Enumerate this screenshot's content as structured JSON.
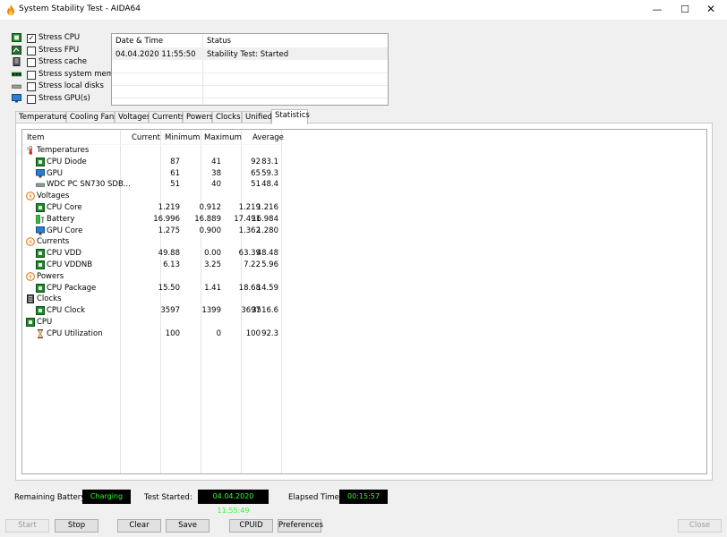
{
  "window": {
    "title": "System Stability Test - AIDA64",
    "minimize": "—",
    "maximize": "☐",
    "close": "✕"
  },
  "stress_options": [
    {
      "label": "Stress CPU",
      "checked": "✓",
      "icon": "cpu-chip-icon"
    },
    {
      "label": "Stress FPU",
      "checked": "",
      "icon": "fpu-chip-icon"
    },
    {
      "label": "Stress cache",
      "checked": "",
      "icon": "cache-icon"
    },
    {
      "label": "Stress system memory",
      "checked": "",
      "icon": "memory-icon"
    },
    {
      "label": "Stress local disks",
      "checked": "",
      "icon": "disk-icon"
    },
    {
      "label": "Stress GPU(s)",
      "checked": "",
      "icon": "gpu-monitor-icon"
    }
  ],
  "log": {
    "headers": {
      "date": "Date & Time",
      "status": "Status"
    },
    "rows": [
      {
        "date": "04.04.2020 11:55:50",
        "status": "Stability Test: Started"
      }
    ]
  },
  "tabs": [
    "Temperatures",
    "Cooling Fans",
    "Voltages",
    "Currents",
    "Powers",
    "Clocks",
    "Unified",
    "Statistics"
  ],
  "active_tab": "Statistics",
  "stats": {
    "headers": {
      "item": "Item",
      "current": "Current",
      "minimum": "Minimum",
      "maximum": "Maximum",
      "average": "Average"
    },
    "rows": [
      {
        "kind": "group",
        "name": "Temperatures",
        "icon": "thermometer-icon"
      },
      {
        "kind": "item",
        "name": "CPU Diode",
        "icon": "cpu-chip-icon",
        "current": "87",
        "minimum": "41",
        "maximum": "92",
        "average": "83.1"
      },
      {
        "kind": "item",
        "name": "GPU",
        "icon": "gpu-monitor-icon",
        "current": "61",
        "minimum": "38",
        "maximum": "65",
        "average": "59.3"
      },
      {
        "kind": "item",
        "name": "WDC PC SN730 SDB...",
        "icon": "disk-icon",
        "current": "51",
        "minimum": "40",
        "maximum": "51",
        "average": "48.4"
      },
      {
        "kind": "group",
        "name": "Voltages",
        "icon": "voltage-icon"
      },
      {
        "kind": "item",
        "name": "CPU Core",
        "icon": "cpu-chip-icon",
        "current": "1.219",
        "minimum": "0.912",
        "maximum": "1.219",
        "average": "1.216"
      },
      {
        "kind": "item",
        "name": "Battery",
        "icon": "battery-icon",
        "current": "16.996",
        "minimum": "16.889",
        "maximum": "17.491",
        "average": "16.984"
      },
      {
        "kind": "item",
        "name": "GPU Core",
        "icon": "gpu-monitor-icon",
        "current": "1.275",
        "minimum": "0.900",
        "maximum": "1.362",
        "average": "1.280"
      },
      {
        "kind": "group",
        "name": "Currents",
        "icon": "current-icon"
      },
      {
        "kind": "item",
        "name": "CPU VDD",
        "icon": "cpu-chip-icon",
        "current": "49.88",
        "minimum": "0.00",
        "maximum": "63.39",
        "average": "48.48"
      },
      {
        "kind": "item",
        "name": "CPU VDDNB",
        "icon": "cpu-chip-icon",
        "current": "6.13",
        "minimum": "3.25",
        "maximum": "7.22",
        "average": "5.96"
      },
      {
        "kind": "group",
        "name": "Powers",
        "icon": "power-icon"
      },
      {
        "kind": "item",
        "name": "CPU Package",
        "icon": "cpu-chip-icon",
        "current": "15.50",
        "minimum": "1.41",
        "maximum": "18.68",
        "average": "14.59"
      },
      {
        "kind": "group",
        "name": "Clocks",
        "icon": "clock-chip-icon"
      },
      {
        "kind": "item",
        "name": "CPU Clock",
        "icon": "cpu-chip-icon",
        "current": "3597",
        "minimum": "1399",
        "maximum": "3697",
        "average": "3516.6"
      },
      {
        "kind": "group",
        "name": "CPU",
        "icon": "cpu-chip-icon"
      },
      {
        "kind": "item",
        "name": "CPU Utilization",
        "icon": "hourglass-icon",
        "current": "100",
        "minimum": "0",
        "maximum": "100",
        "average": "92.3"
      }
    ]
  },
  "status": {
    "battery_label": "Remaining Battery:",
    "battery_value": "Charging",
    "started_label": "Test Started:",
    "started_value": "04.04.2020 11:55:49",
    "elapsed_label": "Elapsed Time:",
    "elapsed_value": "00:15:57"
  },
  "buttons": {
    "start": "Start",
    "stop": "Stop",
    "clear": "Clear",
    "save": "Save",
    "cpuid": "CPUID",
    "preferences": "Preferences",
    "close": "Close"
  },
  "colors": {
    "led_green": "#2cff2c",
    "chip_green": "#1f8a2a",
    "orange": "#e67e22",
    "blue": "#2a7fd4"
  }
}
